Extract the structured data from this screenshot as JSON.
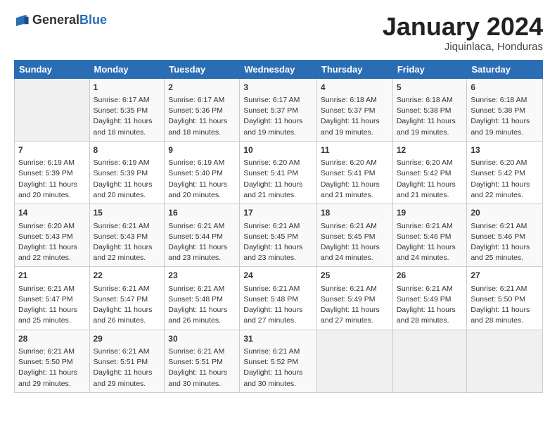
{
  "header": {
    "logo_general": "General",
    "logo_blue": "Blue",
    "month_title": "January 2024",
    "location": "Jiquinlaca, Honduras"
  },
  "weekdays": [
    "Sunday",
    "Monday",
    "Tuesday",
    "Wednesday",
    "Thursday",
    "Friday",
    "Saturday"
  ],
  "weeks": [
    [
      {
        "day": "",
        "content": ""
      },
      {
        "day": "1",
        "content": "Sunrise: 6:17 AM\nSunset: 5:35 PM\nDaylight: 11 hours and 18 minutes."
      },
      {
        "day": "2",
        "content": "Sunrise: 6:17 AM\nSunset: 5:36 PM\nDaylight: 11 hours and 18 minutes."
      },
      {
        "day": "3",
        "content": "Sunrise: 6:17 AM\nSunset: 5:37 PM\nDaylight: 11 hours and 19 minutes."
      },
      {
        "day": "4",
        "content": "Sunrise: 6:18 AM\nSunset: 5:37 PM\nDaylight: 11 hours and 19 minutes."
      },
      {
        "day": "5",
        "content": "Sunrise: 6:18 AM\nSunset: 5:38 PM\nDaylight: 11 hours and 19 minutes."
      },
      {
        "day": "6",
        "content": "Sunrise: 6:18 AM\nSunset: 5:38 PM\nDaylight: 11 hours and 19 minutes."
      }
    ],
    [
      {
        "day": "7",
        "content": "Sunrise: 6:19 AM\nSunset: 5:39 PM\nDaylight: 11 hours and 20 minutes."
      },
      {
        "day": "8",
        "content": "Sunrise: 6:19 AM\nSunset: 5:39 PM\nDaylight: 11 hours and 20 minutes."
      },
      {
        "day": "9",
        "content": "Sunrise: 6:19 AM\nSunset: 5:40 PM\nDaylight: 11 hours and 20 minutes."
      },
      {
        "day": "10",
        "content": "Sunrise: 6:20 AM\nSunset: 5:41 PM\nDaylight: 11 hours and 21 minutes."
      },
      {
        "day": "11",
        "content": "Sunrise: 6:20 AM\nSunset: 5:41 PM\nDaylight: 11 hours and 21 minutes."
      },
      {
        "day": "12",
        "content": "Sunrise: 6:20 AM\nSunset: 5:42 PM\nDaylight: 11 hours and 21 minutes."
      },
      {
        "day": "13",
        "content": "Sunrise: 6:20 AM\nSunset: 5:42 PM\nDaylight: 11 hours and 22 minutes."
      }
    ],
    [
      {
        "day": "14",
        "content": "Sunrise: 6:20 AM\nSunset: 5:43 PM\nDaylight: 11 hours and 22 minutes."
      },
      {
        "day": "15",
        "content": "Sunrise: 6:21 AM\nSunset: 5:43 PM\nDaylight: 11 hours and 22 minutes."
      },
      {
        "day": "16",
        "content": "Sunrise: 6:21 AM\nSunset: 5:44 PM\nDaylight: 11 hours and 23 minutes."
      },
      {
        "day": "17",
        "content": "Sunrise: 6:21 AM\nSunset: 5:45 PM\nDaylight: 11 hours and 23 minutes."
      },
      {
        "day": "18",
        "content": "Sunrise: 6:21 AM\nSunset: 5:45 PM\nDaylight: 11 hours and 24 minutes."
      },
      {
        "day": "19",
        "content": "Sunrise: 6:21 AM\nSunset: 5:46 PM\nDaylight: 11 hours and 24 minutes."
      },
      {
        "day": "20",
        "content": "Sunrise: 6:21 AM\nSunset: 5:46 PM\nDaylight: 11 hours and 25 minutes."
      }
    ],
    [
      {
        "day": "21",
        "content": "Sunrise: 6:21 AM\nSunset: 5:47 PM\nDaylight: 11 hours and 25 minutes."
      },
      {
        "day": "22",
        "content": "Sunrise: 6:21 AM\nSunset: 5:47 PM\nDaylight: 11 hours and 26 minutes."
      },
      {
        "day": "23",
        "content": "Sunrise: 6:21 AM\nSunset: 5:48 PM\nDaylight: 11 hours and 26 minutes."
      },
      {
        "day": "24",
        "content": "Sunrise: 6:21 AM\nSunset: 5:48 PM\nDaylight: 11 hours and 27 minutes."
      },
      {
        "day": "25",
        "content": "Sunrise: 6:21 AM\nSunset: 5:49 PM\nDaylight: 11 hours and 27 minutes."
      },
      {
        "day": "26",
        "content": "Sunrise: 6:21 AM\nSunset: 5:49 PM\nDaylight: 11 hours and 28 minutes."
      },
      {
        "day": "27",
        "content": "Sunrise: 6:21 AM\nSunset: 5:50 PM\nDaylight: 11 hours and 28 minutes."
      }
    ],
    [
      {
        "day": "28",
        "content": "Sunrise: 6:21 AM\nSunset: 5:50 PM\nDaylight: 11 hours and 29 minutes."
      },
      {
        "day": "29",
        "content": "Sunrise: 6:21 AM\nSunset: 5:51 PM\nDaylight: 11 hours and 29 minutes."
      },
      {
        "day": "30",
        "content": "Sunrise: 6:21 AM\nSunset: 5:51 PM\nDaylight: 11 hours and 30 minutes."
      },
      {
        "day": "31",
        "content": "Sunrise: 6:21 AM\nSunset: 5:52 PM\nDaylight: 11 hours and 30 minutes."
      },
      {
        "day": "",
        "content": ""
      },
      {
        "day": "",
        "content": ""
      },
      {
        "day": "",
        "content": ""
      }
    ]
  ]
}
